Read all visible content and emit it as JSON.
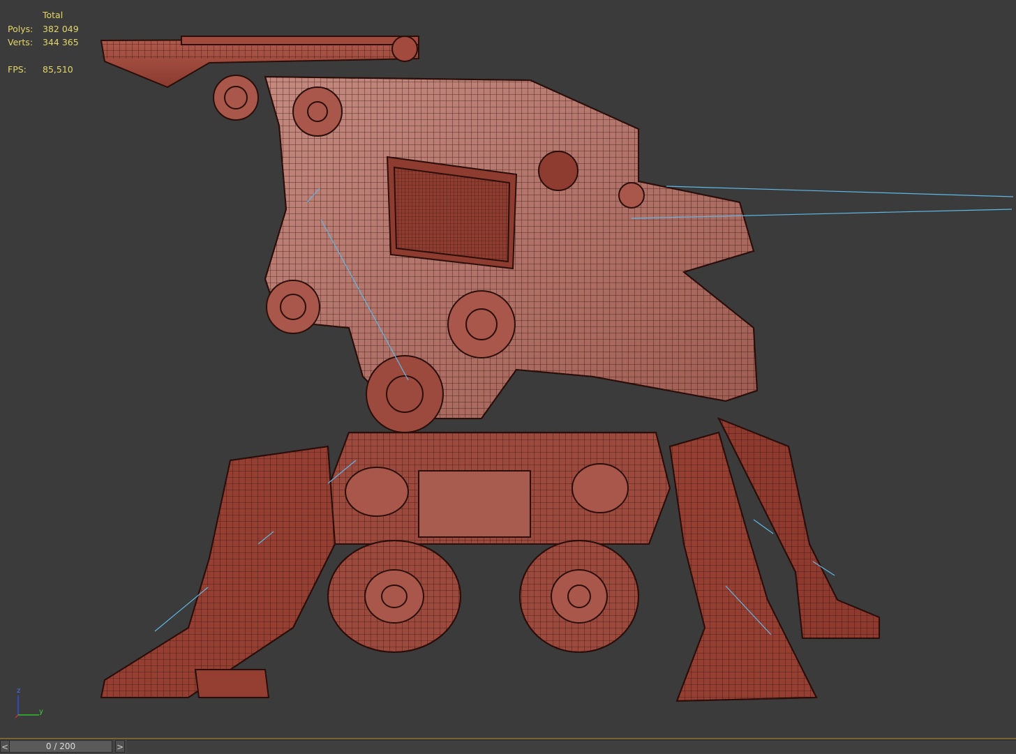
{
  "viewport_stats": {
    "header": "Total",
    "polys_label": "Polys:",
    "polys_value": "382 049",
    "verts_label": "Verts:",
    "verts_value": "344 365",
    "fps_label": "FPS:",
    "fps_value": "85,510"
  },
  "axis_gizmo": {
    "z_label": "z",
    "y_label": "y"
  },
  "timeline": {
    "prev_label": "<",
    "frame_label": "0 / 200",
    "next_label": ">"
  },
  "colors": {
    "viewport_bg": "#3b3b3b",
    "stats_text": "#e5d76a",
    "model_fill": "#9c4a3e",
    "wire": "#3a1510",
    "bone_lines": "#5fb8e6"
  }
}
